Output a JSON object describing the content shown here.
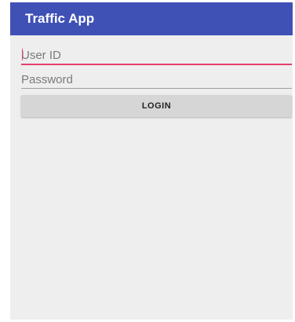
{
  "app_bar": {
    "title": "Traffic App",
    "background_color": "#3f51b5",
    "title_color": "#ffffff"
  },
  "login_form": {
    "user_id": {
      "value": "",
      "placeholder": "User ID",
      "focused": true,
      "accent_color": "#e4406f"
    },
    "password": {
      "value": "",
      "placeholder": "Password"
    },
    "login_button": {
      "label": "LOGIN"
    }
  },
  "theme": {
    "screen_background": "#eeeeee",
    "button_background": "#d6d6d6"
  }
}
